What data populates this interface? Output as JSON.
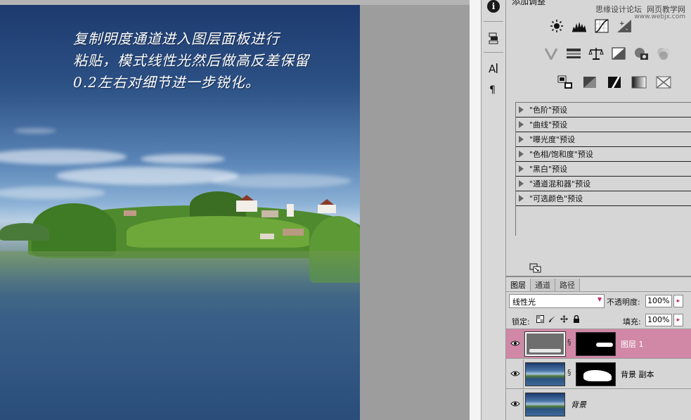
{
  "canvas": {
    "annotation_lines": [
      "复制明度通道进入图层面板进行",
      "粘贴，模式线性光然后做高反差保留",
      "0.2左右对细节进一步锐化。"
    ]
  },
  "adjustments": {
    "title": "添加调整",
    "watermark_left": "思缘设计论坛",
    "watermark_right": "网页教学网",
    "watermark_url": "www.webjx.com",
    "presets": [
      "\"色阶\"预设",
      "\"曲线\"预设",
      "\"曝光度\"预设",
      "\"色相/饱和度\"预设",
      "\"黑白\"预设",
      "\"通道混和器\"预设",
      "\"可选颜色\"预设"
    ]
  },
  "layers": {
    "tabs": [
      "图层",
      "通道",
      "路径"
    ],
    "blend_mode": "线性光",
    "opacity_label": "不透明度:",
    "opacity_value": "100%",
    "lock_label": "锁定:",
    "fill_label": "填充:",
    "fill_value": "100%",
    "items": [
      {
        "name": "图层 1",
        "selected": true
      },
      {
        "name": "背景 副本",
        "selected": false
      },
      {
        "name": "背景",
        "selected": false
      }
    ]
  },
  "colors": {
    "selected_layer": "#d187a6",
    "accent": "#c0296b"
  }
}
